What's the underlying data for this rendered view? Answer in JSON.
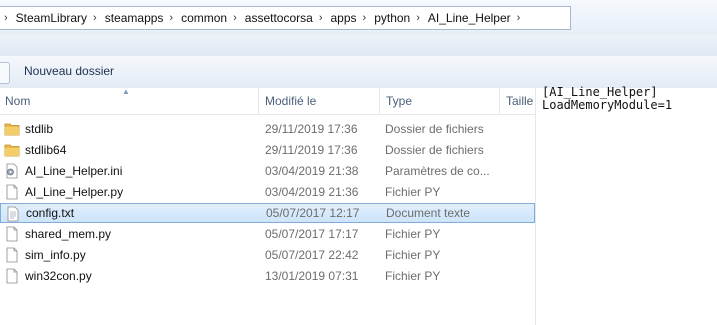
{
  "breadcrumb": {
    "items": [
      "SteamLibrary",
      "steamapps",
      "common",
      "assettocorsa",
      "apps",
      "python",
      "AI_Line_Helper"
    ]
  },
  "toolbar": {
    "new_folder_label": "Nouveau dossier"
  },
  "columns": {
    "name": "Nom",
    "modified": "Modifié le",
    "type": "Type",
    "size": "Taille"
  },
  "files": [
    {
      "name": "stdlib",
      "date": "29/11/2019 17:36",
      "type": "Dossier de fichiers",
      "icon": "folder-icon"
    },
    {
      "name": "stdlib64",
      "date": "29/11/2019 17:36",
      "type": "Dossier de fichiers",
      "icon": "folder-icon"
    },
    {
      "name": "AI_Line_Helper.ini",
      "date": "03/04/2019 21:38",
      "type": "Paramètres de co...",
      "icon": "settings-file-icon"
    },
    {
      "name": "AI_Line_Helper.py",
      "date": "03/04/2019 21:36",
      "type": "Fichier PY",
      "icon": "file-icon"
    },
    {
      "name": "config.txt",
      "date": "05/07/2017 12:17",
      "type": "Document texte",
      "icon": "text-file-icon",
      "selected": true
    },
    {
      "name": "shared_mem.py",
      "date": "05/07/2017 17:17",
      "type": "Fichier PY",
      "icon": "file-icon"
    },
    {
      "name": "sim_info.py",
      "date": "05/07/2017 22:42",
      "type": "Fichier PY",
      "icon": "file-icon"
    },
    {
      "name": "win32con.py",
      "date": "13/01/2019 07:31",
      "type": "Fichier PY",
      "icon": "file-icon"
    }
  ],
  "preview": {
    "lines": [
      "[AI_Line_Helper]",
      "LoadMemoryModule=1"
    ]
  },
  "colors": {
    "selection": "#cde4fb",
    "folder": "#e8b84a"
  }
}
